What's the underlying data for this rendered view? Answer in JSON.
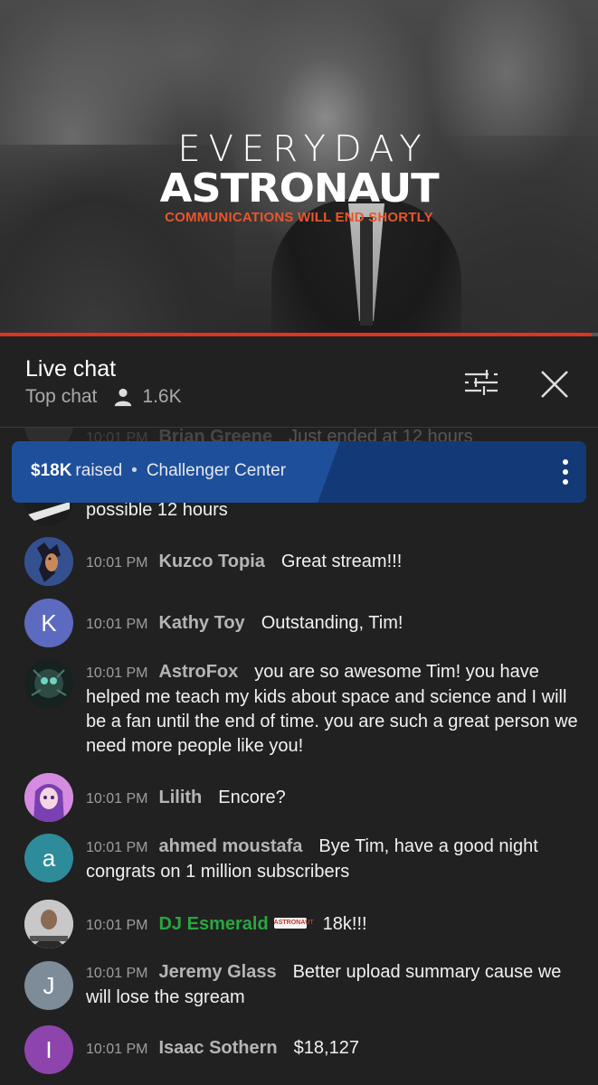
{
  "video": {
    "logo_line1": "EVERYDAY",
    "logo_line2": "ASTRONAUT",
    "tagline": "COMMUNICATIONS WILL END SHORTLY",
    "progress_fraction": 0.99,
    "colors": {
      "tagline": "#e8562c",
      "progress": "#e0331f"
    }
  },
  "chat": {
    "title": "Live chat",
    "mode": "Top chat",
    "viewers": "1.6K",
    "filter_icon": "tune-icon",
    "close_icon": "close-icon"
  },
  "fundraiser": {
    "amount": "$18K",
    "raised_label": "raised",
    "separator": "•",
    "organization": "Challenger Center",
    "color": "#1e4f9a"
  },
  "messages": [
    {
      "time": "10:01 PM",
      "author": "Brian Greene",
      "text": "Just ended at 12 hours"
    },
    {
      "text": "possible 12 hours"
    },
    {
      "time": "10:01 PM",
      "author": "Kuzco Topia",
      "text": "Great stream!!!"
    },
    {
      "time": "10:01 PM",
      "author": "Kathy Toy",
      "avatar_letter": "K",
      "avatar_color": "#5c6bc0",
      "text": "Outstanding, Tim!"
    },
    {
      "time": "10:01 PM",
      "author": "AstroFox",
      "text": "you are so awesome Tim! you have helped me teach my kids about space and science and I will be a fan until the end of time. you are such a great person we need more people like you!"
    },
    {
      "time": "10:01 PM",
      "author": "Lilith",
      "text": "Encore?"
    },
    {
      "time": "10:01 PM",
      "author": "ahmed moustafa",
      "avatar_letter": "a",
      "avatar_color": "#2e8b9a",
      "text": "Bye Tim, have a good night congrats on 1 million subscribers"
    },
    {
      "time": "10:01 PM",
      "author": "DJ Esmerald",
      "badge": "ASTRONAUT",
      "author_color": "#2ba640",
      "text": "18k!!!"
    },
    {
      "time": "10:01 PM",
      "author": "Jeremy Glass",
      "avatar_letter": "J",
      "avatar_color": "#7e8c9a",
      "text": "Better upload summary cause we will lose the sgream"
    },
    {
      "time": "10:01 PM",
      "author": "Isaac Sothern",
      "avatar_letter": "I",
      "avatar_color": "#8e44ad",
      "text": "$18,127"
    }
  ]
}
